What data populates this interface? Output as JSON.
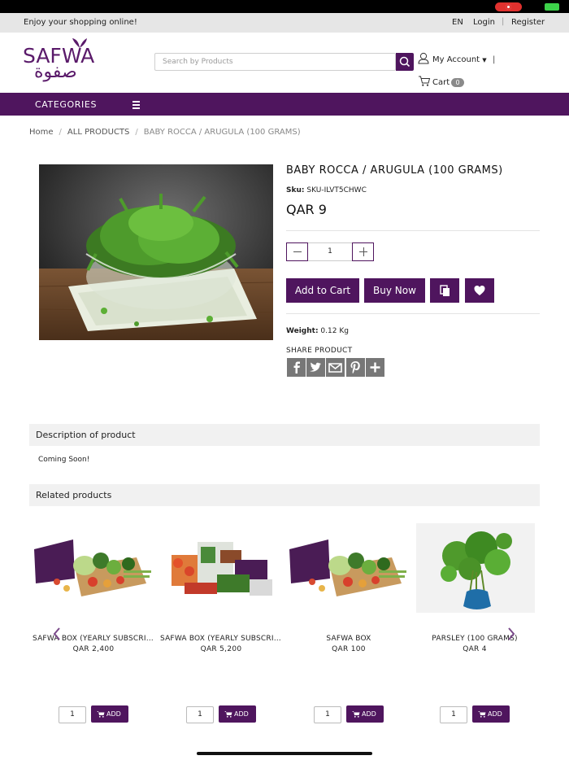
{
  "topbar": {
    "tagline": "Enjoy your shopping online!",
    "lang": "EN",
    "login": "Login",
    "register": "Register"
  },
  "brand": {
    "name_en": "SAFWA",
    "name_ar": "صفوة",
    "color": "#4f155e"
  },
  "search": {
    "placeholder": "Search by Products"
  },
  "account": {
    "label": "My Account"
  },
  "cart": {
    "label": "Cart",
    "count": "0"
  },
  "nav": {
    "categories": "CATEGORIES"
  },
  "breadcrumb": {
    "home": "Home",
    "all": "ALL PRODUCTS",
    "current": "BABY ROCCA / ARUGULA (100 GRAMS)"
  },
  "product": {
    "title": "BABY ROCCA / ARUGULA (100 GRAMS)",
    "sku_label": "Sku:",
    "sku": "SKU-ILVT5CHWC",
    "price": "QAR 9",
    "qty": "1",
    "add_to_cart": "Add to Cart",
    "buy_now": "Buy Now",
    "weight_label": "Weight:",
    "weight": "0.12 Kg",
    "share_label": "SHARE PRODUCT",
    "share_icons": [
      "facebook-icon",
      "twitter-icon",
      "email-icon",
      "pinterest-icon",
      "plus-icon"
    ]
  },
  "description": {
    "heading": "Description of product",
    "text": "Coming Soon!"
  },
  "related": {
    "heading": "Related products",
    "items": [
      {
        "name": "SAFWA BOX (YEARLY SUBSCRIPTION)",
        "price": "QAR 2,400",
        "qty": "1",
        "add": "ADD"
      },
      {
        "name": "SAFWA BOX (YEARLY SUBSCRIPTION)",
        "price": "QAR 5,200",
        "qty": "1",
        "add": "ADD"
      },
      {
        "name": "SAFWA BOX",
        "price": "QAR 100",
        "qty": "1",
        "add": "ADD"
      },
      {
        "name": "PARSLEY (100 GRAMS)",
        "price": "QAR 4",
        "qty": "1",
        "add": "ADD"
      }
    ]
  }
}
